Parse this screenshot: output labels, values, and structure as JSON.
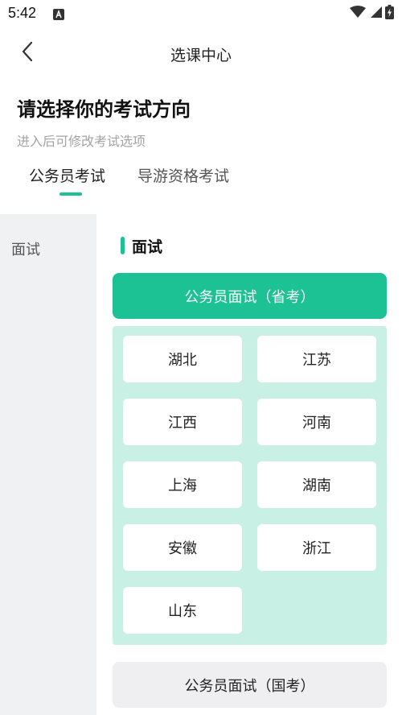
{
  "status_bar": {
    "time": "5:42",
    "icons": [
      "app-a-icon",
      "wifi-icon",
      "signal-icon",
      "battery-charging-icon"
    ]
  },
  "nav": {
    "title": "选课中心",
    "back_icon": "chevron-left-icon"
  },
  "heading": "请选择你的考试方向",
  "subheading": "进入后可修改考试选项",
  "tabs": [
    {
      "label": "公务员考试",
      "active": true
    },
    {
      "label": "导游资格考试",
      "active": false
    }
  ],
  "sidebar": {
    "items": [
      {
        "label": "面试",
        "active": true
      }
    ]
  },
  "main": {
    "section_title": "面试",
    "categories": [
      {
        "label": "公务员面试（省考）",
        "expanded": true,
        "provinces": [
          "湖北",
          "江苏",
          "江西",
          "河南",
          "上海",
          "湖南",
          "安徽",
          "浙江",
          "山东"
        ]
      },
      {
        "label": "公务员面试（国考）",
        "expanded": false
      }
    ]
  },
  "colors": {
    "accent": "#1cc293",
    "panel_bg": "#c8f0e4",
    "rail_bg": "#f0f1f3",
    "muted_text": "#a3a3a3"
  }
}
